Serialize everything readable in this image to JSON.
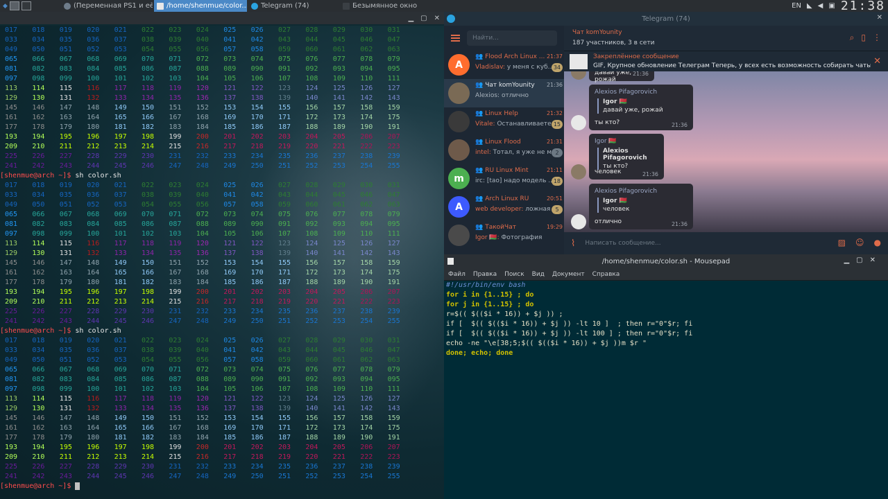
{
  "taskbar": {
    "tasks": [
      {
        "label": "(Переменная PS1 и её ...",
        "active": false
      },
      {
        "label": "/home/shenmue/color...",
        "active": true
      },
      {
        "label": "Telegram (74)",
        "active": false
      },
      {
        "label": "Безымянное окно",
        "active": false
      }
    ],
    "keyboard_layout": "EN",
    "clock": "21:38"
  },
  "terminal": {
    "prompt": "[shenmue@arch ~]$",
    "command": "sh color.sh",
    "palette": {
      "r0": [
        "#1565c0",
        "#1565c0",
        "#1565c0",
        "#1565c0",
        "#1565c0",
        "#2e7d32",
        "#2e7d32",
        "#2e7d32",
        "#1e88e5",
        "#1e88e5",
        "#2e7d32",
        "#2e7d32",
        "#2e7d32",
        "#2e7d32",
        "#2e7d32"
      ],
      "r1": [
        "#2196f3",
        "#26a69a",
        "#26a69a",
        "#26a69a",
        "#26a69a",
        "#26a69a",
        "#26a69a",
        "#4caf50",
        "#4caf50",
        "#4caf50",
        "#4caf50",
        "#4caf50",
        "#4caf50",
        "#4caf50",
        "#4caf50"
      ],
      "r2": [
        "#9ccc65",
        "#b2ff59",
        "#e0e0e0",
        "#b71c1c",
        "#8e24aa",
        "#8e24aa",
        "#8e24aa",
        "#9c27b0",
        "#7e57c2",
        "#7e57c2",
        "#607d8b",
        "#7986cb",
        "#7986cb",
        "#7986cb",
        "#7986cb"
      ],
      "r3": [
        "#8e8e8e",
        "#8e8e8e",
        "#90a4ae",
        "#90a4ae",
        "#90caf9",
        "#90caf9",
        "#90a4ae",
        "#90a4ae",
        "#90caf9",
        "#90caf9",
        "#90caf9",
        "#a5d6a7",
        "#a5d6a7",
        "#a5d6a7",
        "#a5d6a7"
      ],
      "r4": [
        "#b2ff59",
        "#b2ff59",
        "#c6ff00",
        "#c6ff00",
        "#c6ff00",
        "#c6ff00",
        "#e0e0e0",
        "#c62828",
        "#c2185b",
        "#c2185b",
        "#c2185b",
        "#c2185b",
        "#c2185b",
        "#ad1457",
        "#ad1457"
      ],
      "r5": [
        "#6a1b9a",
        "#6a1b9a",
        "#6a1b9a",
        "#5e35b1",
        "#5e35b1",
        "#5e35b1",
        "#1565c0",
        "#1565c0",
        "#1976d2",
        "#1976d2",
        "#1976d2",
        "#1976d2",
        "#1976d2",
        "#1976d2",
        "#1976d2"
      ]
    }
  },
  "telegram": {
    "window_title": "Telegram (74)",
    "search_placeholder": "Найти...",
    "chats": [
      {
        "name": "Flood Arch Linux ...",
        "sender": "Vladislav:",
        "msg": "у меня с куб...",
        "time": "21:37",
        "badge": "34",
        "badge_grey": false,
        "color": "#ff6d2e",
        "glyph": "A",
        "name_orange": true
      },
      {
        "name": "Чат komYounity",
        "sender": "",
        "msg": "Alexios: отлично",
        "time": "21:36",
        "badge": "",
        "badge_grey": false,
        "color": "#7a6a55",
        "glyph": "",
        "name_orange": false
      },
      {
        "name": "Linux Help",
        "sender": "Vitale:",
        "msg": "Останавливаете...",
        "time": "21:32",
        "badge": "15",
        "badge_grey": false,
        "color": "#3a3a3a",
        "glyph": "",
        "name_orange": true
      },
      {
        "name": "Linux Flood",
        "sender": "intel:",
        "msg": "Тотал, я уже не м...",
        "time": "21:31",
        "badge": "2",
        "badge_grey": true,
        "color": "#6e5a4a",
        "glyph": "",
        "name_orange": true
      },
      {
        "name": "RU Linux Mint",
        "sender": "",
        "msg": "irc: [tao] надо модель ...",
        "time": "21:11",
        "badge": "18",
        "badge_grey": false,
        "color": "#4caf50",
        "glyph": "m",
        "name_orange": true
      },
      {
        "name": "Arch Linux RU",
        "sender": "web developer:",
        "msg": "ложная ...",
        "time": "20:51",
        "badge": "5",
        "badge_grey": false,
        "color": "#3d5afe",
        "glyph": "A",
        "name_orange": true
      },
      {
        "name": "ТакойЧат",
        "sender": "Igor 🇧🇾:",
        "msg": "Фотография",
        "time": "19:29",
        "badge": "",
        "badge_grey": false,
        "color": "#4a4a4a",
        "glyph": "",
        "name_orange": true
      }
    ],
    "chat_title": "Чат komYounity",
    "chat_status": "187 участников, 3 в сети",
    "pinned_label": "Закреплённое сообщение",
    "pinned_text": "GIF, Крупное обновление Телеграм  Теперь, у всех есть возможность собирать чаты и ка...",
    "messages": [
      {
        "from": "",
        "reply_name": "",
        "reply_text": "",
        "body": "давай уже, рожай",
        "time": "21:36"
      },
      {
        "from": "Alexios Pifagorovich",
        "reply_name": "Igor 🇧🇾",
        "reply_text": "давай уже, рожай",
        "body": "ты кто?",
        "time": "21:36"
      },
      {
        "from": "Igor 🇧🇾",
        "reply_name": "Alexios Pifagorovich",
        "reply_text": "ты кто?",
        "body": "человек",
        "time": "21:36"
      },
      {
        "from": "Alexios Pifagorovich",
        "reply_name": "Igor 🇧🇾",
        "reply_text": "человек",
        "body": "отлично",
        "time": "21:36"
      }
    ],
    "composer_placeholder": "Написать сообщение..."
  },
  "mousepad": {
    "title": "/home/shenmue/color.sh - Mousepad",
    "menu": [
      "Файл",
      "Правка",
      "Поиск",
      "Вид",
      "Документ",
      "Справка"
    ],
    "code": [
      "#!/usr/bin/env bash",
      "for i in {1..15} ; do",
      "for j in {1..15} ; do",
      "r=$(( $(($i * 16)) + $j )) ;",
      "if [  $(( $(($i * 16)) + $j )) -lt 10 ]  ; then r=\"0\"$r; fi",
      "if [  $(( $(($i * 16)) + $j )) -lt 100 ] ; then r=\"0\"$r; fi",
      "echo -ne \"\\e[38;5;$(( $(($i * 16)) + $j ))m $r \"",
      "done; echo; done"
    ]
  }
}
